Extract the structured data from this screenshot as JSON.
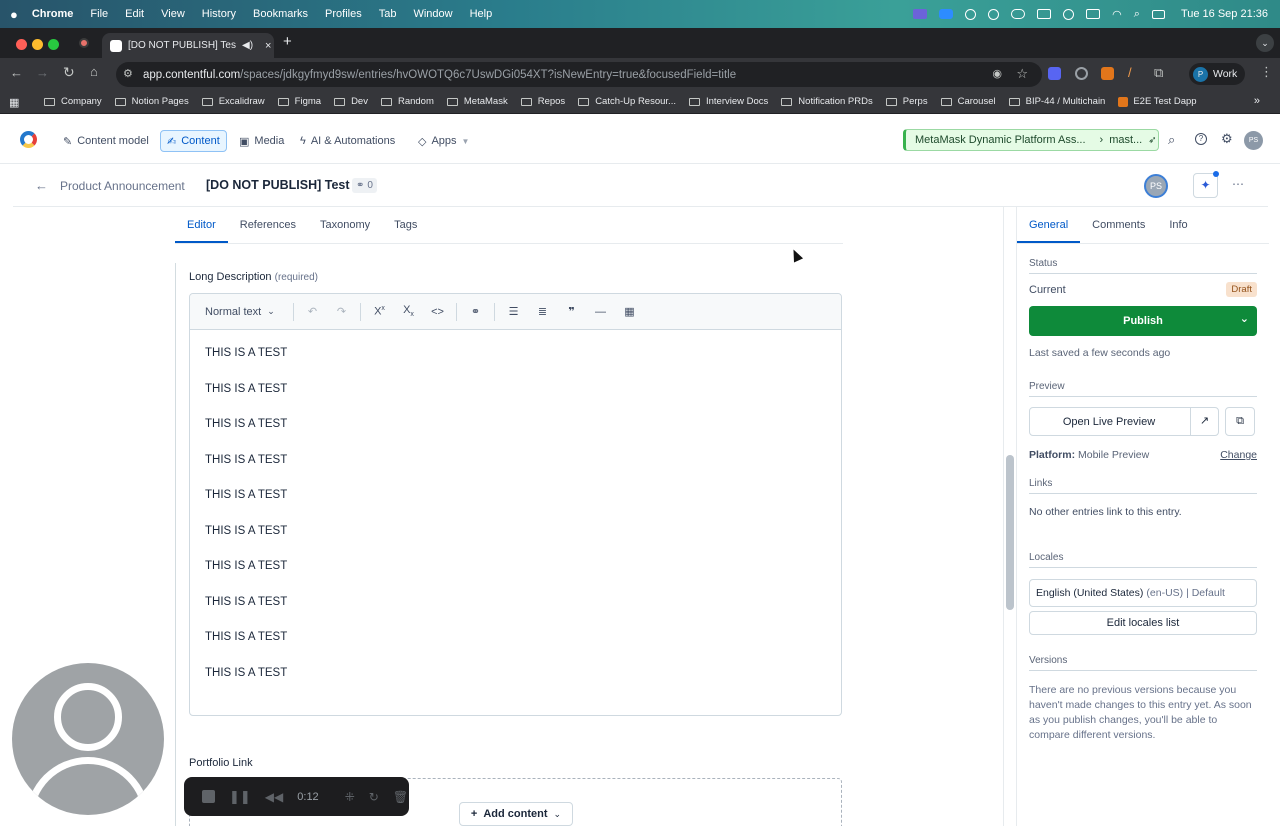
{
  "mac_menu": {
    "app": "Chrome",
    "items": [
      "File",
      "Edit",
      "View",
      "History",
      "Bookmarks",
      "Profiles",
      "Tab",
      "Window",
      "Help"
    ],
    "clock": "Tue 16 Sep  21:36"
  },
  "browser": {
    "tab_title": "[DO NOT PUBLISH] Test",
    "url_host": "app.contentful.com",
    "url_path": "/spaces/jdkgyfmyd9sw/entries/hvOWOTQ6c7UswDGi054XT?isNewEntry=true&focusedField=title",
    "profile_label": "Work",
    "profile_initial": "P",
    "bookmarks": [
      "Company",
      "Notion Pages",
      "Excalidraw",
      "Figma",
      "Dev",
      "Random",
      "MetaMask",
      "Repos",
      "Catch-Up Resour...",
      "Interview Docs",
      "Notification PRDs",
      "Perps",
      "Carousel",
      "BIP-44 / Multichain",
      "E2E Test Dapp"
    ]
  },
  "app_nav": {
    "items": [
      {
        "label": "Content model",
        "icon": "wrench-icon"
      },
      {
        "label": "Content",
        "icon": "edit-icon",
        "active": true
      },
      {
        "label": "Media",
        "icon": "image-icon"
      },
      {
        "label": "AI & Automations",
        "icon": "bolt-icon"
      },
      {
        "label": "Apps",
        "icon": "puzzle-icon"
      }
    ],
    "environment": "MetaMask Dynamic Platform Ass...",
    "branch": "mast...",
    "user_initials": "PS"
  },
  "entry": {
    "content_type": "Product Announcement",
    "title": "[DO NOT PUBLISH] Test",
    "link_count": "0",
    "user_initials": "PS"
  },
  "editor": {
    "tabs": [
      "Editor",
      "References",
      "Taxonomy",
      "Tags"
    ],
    "active_tab": "Editor",
    "field_label": "Long Description",
    "field_required": "(required)",
    "format_select": "Normal text",
    "paragraphs": [
      "THIS IS A TEST",
      "THIS IS A TEST",
      "THIS IS A TEST",
      "THIS IS A TEST",
      "THIS IS A TEST",
      "THIS IS A TEST",
      "THIS IS A TEST",
      "THIS IS A TEST",
      "THIS IS A TEST",
      "THIS IS A TEST"
    ],
    "portfolio_label": "Portfolio Link",
    "add_content": "Add content"
  },
  "sidebar": {
    "tabs": [
      "General",
      "Comments",
      "Info"
    ],
    "status_heading": "Status",
    "current_label": "Current",
    "status_badge": "Draft",
    "publish_label": "Publish",
    "last_saved": "Last saved a few seconds ago",
    "preview_heading": "Preview",
    "open_preview": "Open Live Preview",
    "platform_key": "Platform:",
    "platform_value": "Mobile Preview",
    "change_link": "Change",
    "links_heading": "Links",
    "links_text": "No other entries link to this entry.",
    "locales_heading": "Locales",
    "locale_name": "English (United States)",
    "locale_code": "(en-US) | Default",
    "edit_locales": "Edit locales list",
    "versions_heading": "Versions",
    "versions_text": "There are no previous versions because you haven't made changes to this entry yet. As soon as you publish changes, you'll be able to compare different versions."
  },
  "recorder": {
    "time": "0:12"
  },
  "colors": {
    "publish_green": "#0e8a3a",
    "accent_blue": "#0059c8",
    "draft_badge": "#f8e1cd"
  }
}
